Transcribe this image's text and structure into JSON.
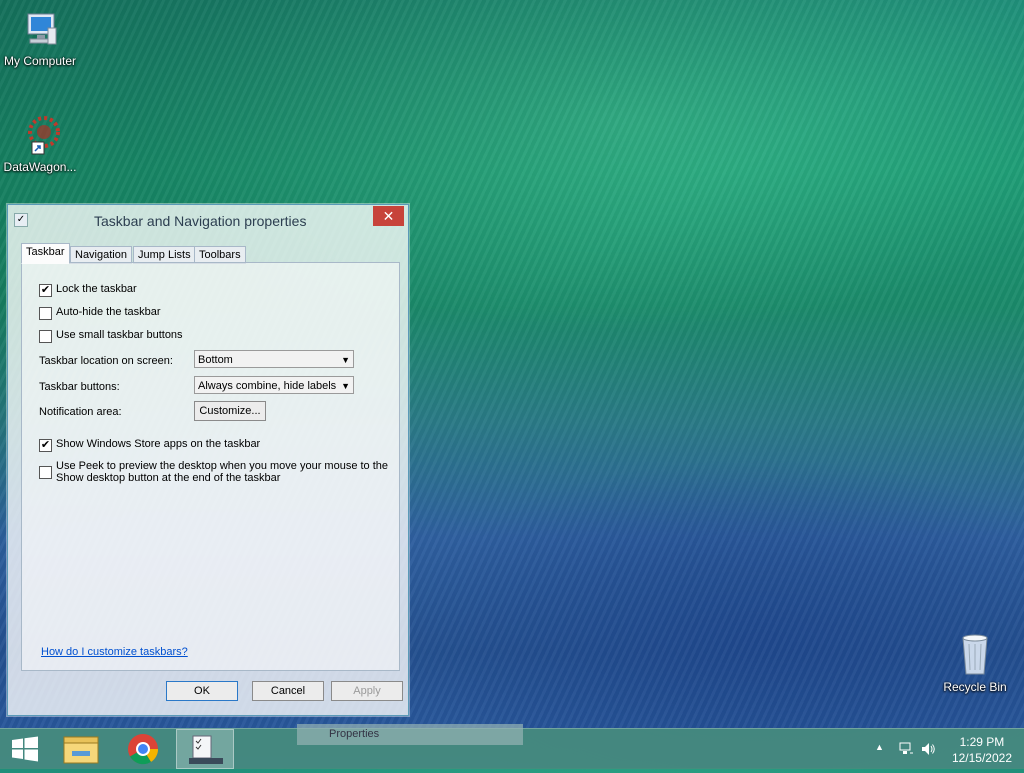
{
  "desktop": {
    "icons": [
      {
        "label": "My Computer",
        "icon": "computer-icon"
      },
      {
        "label": "DataWagon...",
        "icon": "datawagon-icon"
      },
      {
        "label": "Recycle Bin",
        "icon": "recycle-bin-icon"
      }
    ]
  },
  "window": {
    "title": "Taskbar and Navigation properties",
    "close_label": "✕",
    "tabs": [
      "Taskbar",
      "Navigation",
      "Jump Lists",
      "Toolbars"
    ],
    "active_tab": "Taskbar",
    "options": {
      "lock_taskbar": {
        "label": "Lock the taskbar",
        "checked": true
      },
      "auto_hide": {
        "label": "Auto-hide the taskbar",
        "checked": false
      },
      "small_buttons": {
        "label": "Use small taskbar buttons",
        "checked": false
      },
      "store_apps": {
        "label": "Show Windows Store apps on the taskbar",
        "checked": true
      },
      "peek": {
        "label_line1": "Use Peek to preview the desktop when you move your mouse to the",
        "label_line2": "Show desktop button at the end of the taskbar",
        "checked": false
      }
    },
    "location": {
      "label": "Taskbar location on screen:",
      "value": "Bottom"
    },
    "buttons_setting": {
      "label": "Taskbar buttons:",
      "value": "Always combine, hide labels"
    },
    "notification": {
      "label": "Notification area:",
      "button": "Customize..."
    },
    "help_link": "How do I customize taskbars?",
    "footer": {
      "ok": "OK",
      "cancel": "Cancel",
      "apply": "Apply"
    }
  },
  "taskbar": {
    "tooltip": "Properties",
    "clock_time": "1:29 PM",
    "clock_date": "12/15/2022",
    "tray_icons": [
      "show-hidden-icons-icon",
      "network-icon",
      "volume-icon"
    ]
  },
  "colors": {
    "close_button": "#c7433a",
    "taskbar": "#468c7d",
    "link": "#0050d0"
  }
}
